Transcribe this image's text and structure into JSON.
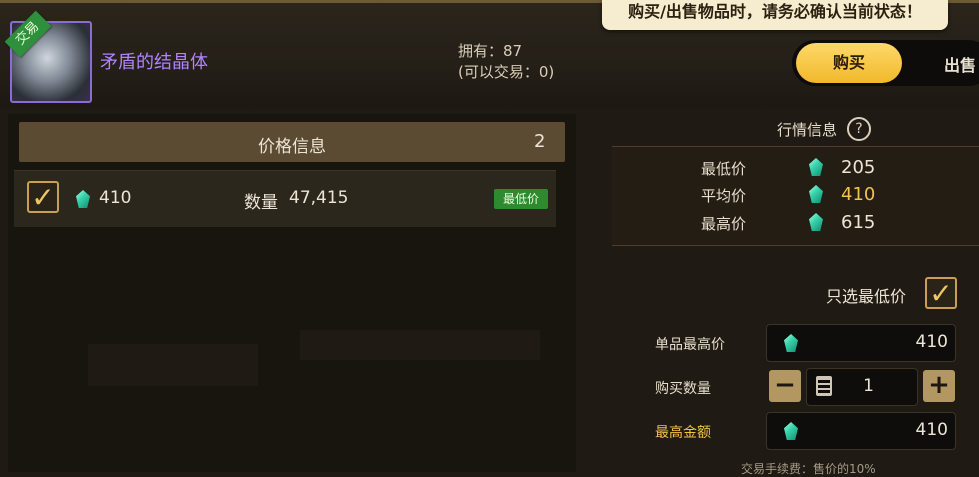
{
  "tooltip": "购买/出售物品时，请务必确认当前状态！",
  "item": {
    "name": "矛盾的结晶体",
    "trade_tag": "交易",
    "owned": "拥有：87",
    "tradable": "(可以交易：0)"
  },
  "mode_toggle": {
    "buy": "购买",
    "sell": "出售"
  },
  "price_info": {
    "title": "价格信息",
    "count": "2",
    "rows": [
      {
        "price": "410",
        "qty_label": "数量",
        "qty": "47,415",
        "badge": "最低价"
      }
    ]
  },
  "market": {
    "title": "行情信息",
    "help_icon": "?",
    "rows": [
      {
        "label": "最低价",
        "value": "205"
      },
      {
        "label": "平均价",
        "value": "410"
      },
      {
        "label": "最高价",
        "value": "615"
      }
    ]
  },
  "form": {
    "only_lowest_label": "只选最低价",
    "max_unit_price_label": "单品最高价",
    "max_unit_price": "410",
    "buy_qty_label": "购买数量",
    "buy_qty": "1",
    "max_total_label": "最高金额",
    "max_total": "410",
    "fee_text": "交易手续费：售价的10%"
  },
  "colors": {
    "accent_gold": "#f2c34b",
    "item_purple": "#b083ff",
    "badge_green": "#2e8a2f"
  }
}
